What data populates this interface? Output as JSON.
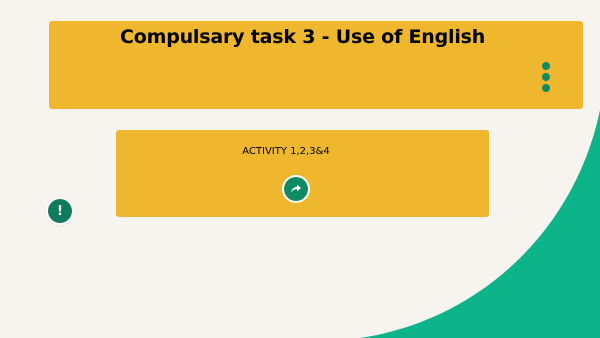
{
  "colors": {
    "background": "#f7f4f0",
    "card": "#efb72e",
    "accent": "#0f8a62",
    "curve": "#0db48a"
  },
  "header": {
    "title": "Compulsary task 3 - Use of English",
    "menu_icon": "more-vertical-icon"
  },
  "activity": {
    "title": "ACTIVITY 1,2,3&4",
    "action_icon": "share-arrow-icon"
  },
  "alert": {
    "symbol": "!",
    "icon": "exclamation-icon"
  }
}
